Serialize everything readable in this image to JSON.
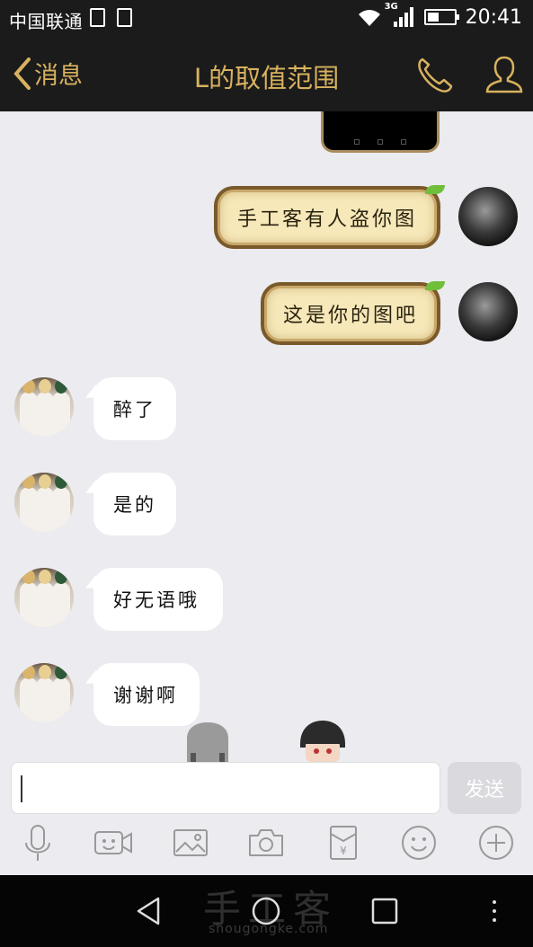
{
  "status_bar": {
    "carrier": "中国联通",
    "network": "3G",
    "time": "20:41",
    "battery_percent": 45
  },
  "nav": {
    "back_label": "消息",
    "title": "L的取值范围",
    "accent_color": "#d8b25e"
  },
  "messages": [
    {
      "sender": "me",
      "style": "parchment",
      "text": "手工客有人盗你图"
    },
    {
      "sender": "me",
      "style": "parchment",
      "text": "这是你的图吧"
    },
    {
      "sender": "other",
      "style": "bubble",
      "text": "醉了"
    },
    {
      "sender": "other",
      "style": "bubble",
      "text": "是的"
    },
    {
      "sender": "other",
      "style": "bubble",
      "text": "好无语哦"
    },
    {
      "sender": "other",
      "style": "bubble",
      "text": "谢谢啊"
    }
  ],
  "input": {
    "value": "",
    "send_label": "发送"
  },
  "toolbar": [
    "microphone-icon",
    "video-chat-icon",
    "image-icon",
    "camera-icon",
    "red-packet-icon",
    "emoji-icon",
    "plus-icon"
  ],
  "watermark": {
    "title": "手工客",
    "url": "shougongke.com"
  }
}
